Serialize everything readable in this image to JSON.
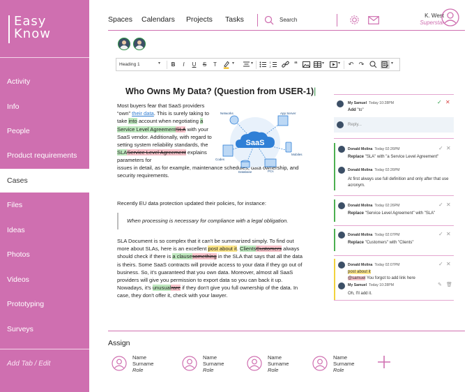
{
  "app": {
    "logo_line1": "Easy",
    "logo_line2": "Know",
    "accent_color": "#cf6fb0"
  },
  "sidebar": {
    "items": [
      {
        "label": "Activity"
      },
      {
        "label": "Info"
      },
      {
        "label": "People"
      },
      {
        "label": "Product requirements"
      },
      {
        "label": "Cases",
        "active": true
      },
      {
        "label": "Files"
      },
      {
        "label": "Ideas"
      },
      {
        "label": "Photos"
      },
      {
        "label": "Videos"
      },
      {
        "label": "Prototyping"
      },
      {
        "label": "Surveys"
      }
    ],
    "add_tab": "Add Tab / Edit"
  },
  "topnav": {
    "links": [
      "Spaces",
      "Calendars",
      "Projects",
      "Tasks"
    ],
    "search_placeholder": "Search",
    "user_name": "K. West",
    "user_role": "Superstar",
    "icons": [
      "search-icon",
      "gear-icon",
      "mail-icon",
      "user-avatar-icon"
    ]
  },
  "toolbar": {
    "heading_select": "Heading 1",
    "bold": "B",
    "italic": "I",
    "underline": "U",
    "strike": "S",
    "clear": "T",
    "icons": [
      "bold-icon",
      "italic-icon",
      "underline-icon",
      "strikethrough-icon",
      "clear-format-icon",
      "highlight-icon",
      "align-icon",
      "bullet-list-icon",
      "numbered-list-icon",
      "link-icon",
      "quote-icon",
      "image-icon",
      "table-icon",
      "media-icon",
      "undo-icon",
      "redo-icon",
      "comment-icon",
      "track-changes-icon"
    ]
  },
  "document": {
    "title": "Who Owns My Data? (Question from USER-1)",
    "p1": {
      "a": "Most buyers fear that SaaS providers “own” ",
      "link": "their data",
      "b": ". This is surely taking to take ",
      "b2": "into",
      "b3": " account when negotiating ",
      "ins1": "a Service Level Agreement",
      "del1": "SLA",
      "c": " with your SaaS vendor. Additionally, with regard to setting system reliability standards, the ",
      "ins2": "SLA",
      "del2": "Service Level Agreement",
      "d": " explains parameters for"
    },
    "p1_end": "issues in detail, as for example, maintenance schedules, data ownership, and security requirements.",
    "p2": "Recently EU data protection updated their policies, for instance:",
    "quote": "When processing is necessary for compliance with a legal obligation.",
    "p3": {
      "a": "SLA Document is so complex that it can't be summarized simply. To find out more about SLAs, here is an excellent ",
      "hl": "post about it",
      "b": ". ",
      "ins1": "Clients",
      "del1": "Customers",
      "c": " always should check if there is ",
      "ins2": "a clause",
      "del2": "something",
      "d": " in the SLA that says that all the data is theirs.  Some SaaS contracts will provide access to your data if they go out of business. So, it's guaranteed that you own data. Moreover, almost all SaaS providers will give you permission to export data so you can back it up. Nowadays, it's ",
      "ins3": "unusual",
      "del3": "rare",
      "e": " if they don't give you full ownership of the data. In case, they don't offer it, check with your lawyer."
    },
    "illustration": {
      "center": "SaaS",
      "labels": [
        "Networks",
        "App Server",
        "Codes",
        "Mobiles",
        "Database",
        "PCs"
      ]
    }
  },
  "comments": [
    {
      "author": "My Samuel",
      "time": "Today 10:28PM",
      "action": "Add",
      "detail": "\"to\"",
      "bar": "#cf6fb0"
    },
    {
      "reply_placeholder": "Reply..."
    },
    {
      "author": "Donald Molina",
      "time": "Today 02:26PM",
      "action": "Replace",
      "detail": "\"SLA\" with \"a Service Level Agreement\"",
      "bar": "#4caf50"
    },
    {
      "author": "Donald Molina",
      "time": "Today 02:26PM",
      "text": "At first always use full definition and only after that use acronym.",
      "bar": "#4caf50"
    },
    {
      "author": "Donald Molina",
      "time": "Today 02:26PM",
      "action": "Replace",
      "detail": "\"Service Level Agreement\" with \"SLA\"",
      "bar": "#4caf50"
    },
    {
      "author": "Donald Molina",
      "time": "Today 02:07PM",
      "action": "Replace",
      "detail": "\"Customers\" with \"Clients\"",
      "bar": "#4caf50"
    },
    {
      "author": "Donald Molina",
      "time": "Today 02:07PM",
      "text": "post about it",
      "mention": "@samuel",
      "text2": "You forgot to add link here",
      "bar": "#f2d23c"
    },
    {
      "author": "My Samuel",
      "time": "Today 10:28PM",
      "text": "Oh, I'll add it.",
      "bar": "#f2d23c"
    }
  ],
  "assign": {
    "title": "Assign",
    "people": [
      {
        "name": "Name",
        "surname": "Surname",
        "role": "Role"
      },
      {
        "name": "Name",
        "surname": "Surname",
        "role": "Role"
      },
      {
        "name": "Name",
        "surname": "Surname",
        "role": "Role"
      },
      {
        "name": "Name",
        "surname": "Surname",
        "role": "Role"
      }
    ]
  }
}
